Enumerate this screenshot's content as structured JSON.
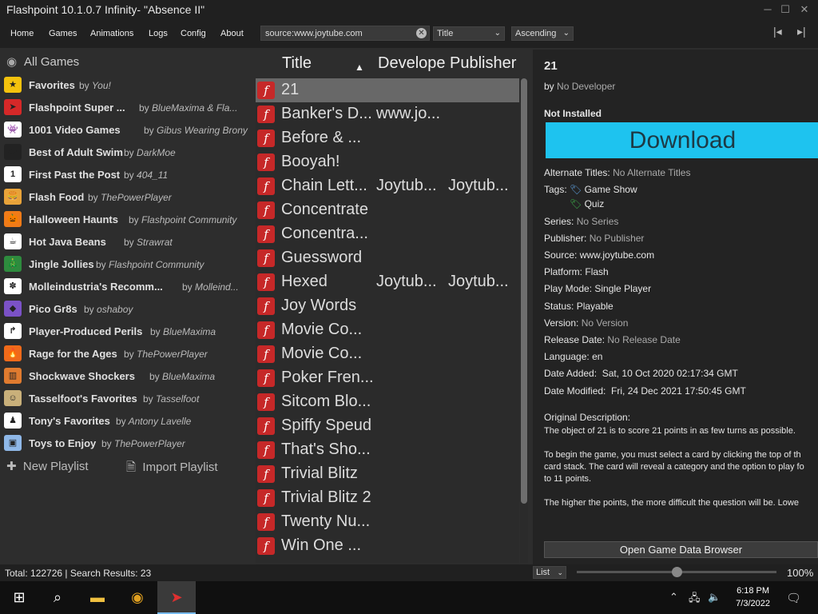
{
  "window": {
    "title": "Flashpoint 10.1.0.7 Infinity- \"Absence II\""
  },
  "menu": [
    "Home",
    "Games",
    "Animations",
    "Logs",
    "Config",
    "About"
  ],
  "search": {
    "value": "source:www.joytube.com"
  },
  "sort": {
    "field": "Title",
    "order": "Ascending"
  },
  "sidebar": {
    "all_games": "All Games",
    "playlists": [
      {
        "name": "Favorites",
        "by": "by",
        "author": "You!",
        "color": "#f4c20d",
        "glyph": "★"
      },
      {
        "name": "Flashpoint Super ...",
        "by": "by",
        "author": "BlueMaxima & Fla...",
        "color": "#d62828",
        "glyph": "➤"
      },
      {
        "name": "1001 Video Games",
        "by": "by",
        "author": "Gibus Wearing Brony",
        "color": "#ffffff",
        "glyph": "👾"
      },
      {
        "name": "Best of Adult Swim",
        "by": "by",
        "author": "DarkMoe",
        "color": "#222222",
        "glyph": "[as]"
      },
      {
        "name": "First Past the Post",
        "by": "by",
        "author": "404_11",
        "color": "#ffffff",
        "glyph": "1"
      },
      {
        "name": "Flash Food",
        "by": "by",
        "author": "ThePowerPlayer",
        "color": "#e8a33a",
        "glyph": "🍔"
      },
      {
        "name": "Halloween Haunts",
        "by": "by",
        "author": "Flashpoint Community",
        "color": "#f07b18",
        "glyph": "🎃"
      },
      {
        "name": "Hot Java Beans",
        "by": "by",
        "author": "Strawrat",
        "color": "#ffffff",
        "glyph": "☕"
      },
      {
        "name": "Jingle Jollies",
        "by": "by",
        "author": "Flashpoint Community",
        "color": "#2e8b3e",
        "glyph": "🎄"
      },
      {
        "name": "Molleindustria's Recomm...",
        "by": "by",
        "author": "Molleind...",
        "color": "#ffffff",
        "glyph": "✽"
      },
      {
        "name": "Pico Gr8s",
        "by": "by",
        "author": "oshaboy",
        "color": "#7b52c7",
        "glyph": "◆"
      },
      {
        "name": "Player-Produced Perils",
        "by": "by",
        "author": "BlueMaxima",
        "color": "#ffffff",
        "glyph": "↱"
      },
      {
        "name": "Rage for the Ages",
        "by": "by",
        "author": "ThePowerPlayer",
        "color": "#f06a1a",
        "glyph": "🔥"
      },
      {
        "name": "Shockwave Shockers",
        "by": "by",
        "author": "BlueMaxima",
        "color": "#e07b2f",
        "glyph": "▥"
      },
      {
        "name": "Tasselfoot's Favorites",
        "by": "by",
        "author": "Tasselfoot",
        "color": "#c9b07a",
        "glyph": "☺"
      },
      {
        "name": "Tony's Favorites",
        "by": "by",
        "author": "Antony Lavelle",
        "color": "#ffffff",
        "glyph": "♟"
      },
      {
        "name": "Toys to Enjoy",
        "by": "by",
        "author": "ThePowerPlayer",
        "color": "#8fb8e8",
        "glyph": "▣"
      }
    ],
    "new_playlist": "New Playlist",
    "import_playlist": "Import Playlist"
  },
  "columns": {
    "title": "Title",
    "developer": "Develope",
    "publisher": "Publisher",
    "sort_icon": "▲"
  },
  "games": [
    {
      "title": "21",
      "developer": "",
      "publisher": "",
      "selected": true
    },
    {
      "title": "Banker's D...",
      "developer": "www.jo...",
      "publisher": ""
    },
    {
      "title": "Before & ...",
      "developer": "",
      "publisher": ""
    },
    {
      "title": "Booyah!",
      "developer": "",
      "publisher": ""
    },
    {
      "title": "Chain Lett...",
      "developer": "Joytub...",
      "publisher": "Joytub..."
    },
    {
      "title": "Concentrate",
      "developer": "",
      "publisher": ""
    },
    {
      "title": "Concentra...",
      "developer": "",
      "publisher": ""
    },
    {
      "title": "Guessword",
      "developer": "",
      "publisher": ""
    },
    {
      "title": "Hexed",
      "developer": "Joytub...",
      "publisher": "Joytub..."
    },
    {
      "title": "Joy Words",
      "developer": "",
      "publisher": ""
    },
    {
      "title": "Movie Co...",
      "developer": "",
      "publisher": ""
    },
    {
      "title": "Movie Co...",
      "developer": "",
      "publisher": ""
    },
    {
      "title": "Poker Fren...",
      "developer": "",
      "publisher": ""
    },
    {
      "title": "Sitcom Blo...",
      "developer": "",
      "publisher": ""
    },
    {
      "title": "Spiffy Speud",
      "developer": "",
      "publisher": ""
    },
    {
      "title": "That's Sho...",
      "developer": "",
      "publisher": ""
    },
    {
      "title": "Trivial Blitz",
      "developer": "",
      "publisher": ""
    },
    {
      "title": "Trivial Blitz 2",
      "developer": "",
      "publisher": ""
    },
    {
      "title": "Twenty Nu...",
      "developer": "",
      "publisher": ""
    },
    {
      "title": "Win One ...",
      "developer": "",
      "publisher": ""
    }
  ],
  "detail": {
    "title": "21",
    "by": "by",
    "developer": "No Developer",
    "install_status": "Not Installed",
    "download": "Download",
    "alt_titles_k": "Alternate Titles:",
    "alt_titles_v": "No Alternate Titles",
    "tags_k": "Tags:",
    "tag1": "Game Show",
    "tag2": "Quiz",
    "series_k": "Series:",
    "series_v": "No Series",
    "publisher_k": "Publisher:",
    "publisher_v": "No Publisher",
    "source_k": "Source:",
    "source_v": "www.joytube.com",
    "platform_k": "Platform:",
    "platform_v": "Flash",
    "playmode_k": "Play Mode:",
    "playmode_v": "Single Player",
    "status_k": "Status:",
    "status_v": "Playable",
    "version_k": "Version:",
    "version_v": "No Version",
    "release_k": "Release Date:",
    "release_v": "No Release Date",
    "language_k": "Language:",
    "language_v": "en",
    "added_k": "Date Added:",
    "added_v": "Sat, 10 Oct 2020 02:17:34 GMT",
    "modified_k": "Date Modified:",
    "modified_v": "Fri, 24 Dec 2021 17:50:45 GMT",
    "orig_desc_k": "Original Description:",
    "desc1": "The object of 21 is to score 21 points in as few turns as possible.",
    "desc2": "To begin the game, you must select a card by clicking the top of th",
    "desc3": "card stack. The card will reveal a category and the option to play fo",
    "desc4": "to 11 points.",
    "desc5": "The higher the points, the more difficult the question will be. Lowe",
    "browser_button": "Open Game Data Browser"
  },
  "footer": {
    "totals": "Total: 122726  |  Search Results: 23",
    "view": "List",
    "zoom": "100%",
    "zoom_level": 0.5
  },
  "taskbar": {
    "time": "6:18 PM",
    "date": "7/3/2022"
  }
}
